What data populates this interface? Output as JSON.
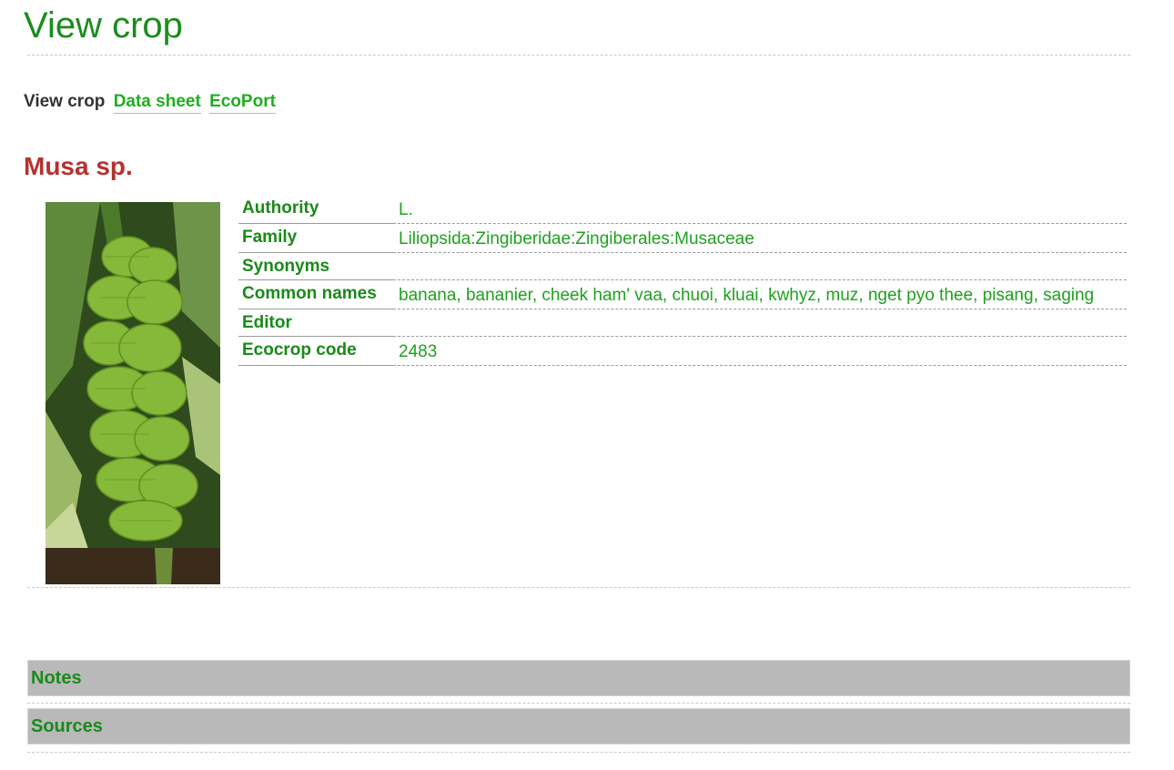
{
  "page": {
    "title": "View crop"
  },
  "tabs": {
    "current": "View crop",
    "data_sheet": "Data sheet",
    "ecoport": "EcoPort"
  },
  "crop": {
    "name": "Musa sp.",
    "image_icon": "banana-bunch-photo"
  },
  "info": {
    "authority_label": "Authority",
    "authority_value": "L.",
    "family_label": "Family",
    "family_value": "Liliopsida:Zingiberidae:Zingiberales:Musaceae",
    "synonyms_label": "Synonyms",
    "synonyms_value": "",
    "common_names_label": "Common names",
    "common_names_value": "banana, bananier, cheek ham' vaa, chuoi, kluai, kwhyz, muz, nget pyo thee, pisang, saging",
    "editor_label": "Editor",
    "editor_value": "",
    "ecocrop_code_label": "Ecocrop code",
    "ecocrop_code_value": "2483"
  },
  "sections": {
    "notes": "Notes",
    "sources": "Sources"
  },
  "colors": {
    "title_green": "#1b8c1b",
    "link_green": "#1fae1f",
    "crop_red": "#b5322f",
    "section_gray": "#b9b9b9"
  }
}
